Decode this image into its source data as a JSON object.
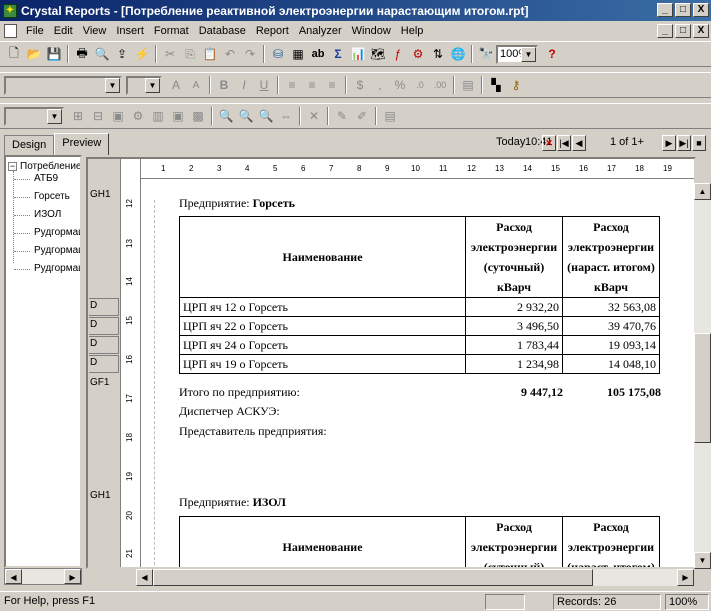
{
  "window": {
    "app_name": "Crystal Reports",
    "document": "[Потребление реактивной электроэнергии нарастающим итогом.rpt]",
    "app_icon": "crystal-reports-icon",
    "minimize": "_",
    "maximize": "□",
    "close": "X"
  },
  "menu": [
    "File",
    "Edit",
    "View",
    "Insert",
    "Format",
    "Database",
    "Report",
    "Analyzer",
    "Window",
    "Help"
  ],
  "toolbar": {
    "zoom": "100%"
  },
  "tabs": {
    "design": "Design",
    "preview": "Preview"
  },
  "tree": {
    "root": "Потребление р",
    "items": [
      "АТБ9",
      "Горсеть",
      "ИЗОЛ",
      "Рудгормащ",
      "Рудгормащ",
      "Рудгормащ"
    ]
  },
  "nav": {
    "today": "Today",
    "time": "10:41",
    "page": "1 of 1+"
  },
  "sections": {
    "gh": "GH1",
    "detail": "D",
    "gf": "GF1"
  },
  "ruler": {
    "h": [
      "1",
      "2",
      "3",
      "4",
      "5",
      "6",
      "7",
      "8",
      "9",
      "10",
      "11",
      "12",
      "13",
      "14",
      "15",
      "16",
      "17",
      "18",
      "19"
    ],
    "v": [
      "12",
      "13",
      "14",
      "15",
      "16",
      "17",
      "18",
      "19",
      "20",
      "21"
    ]
  },
  "report": {
    "group1": {
      "label": "Предприятие:",
      "name": "Горсеть",
      "col_name": "Наименование",
      "col_daily": [
        "Расход",
        "электроэнергии",
        "(суточный)",
        "кВарч"
      ],
      "col_cumul": [
        "Расход",
        "электроэнергии",
        "(нараст. итогом)",
        "кВарч"
      ],
      "rows": [
        {
          "name": "ЦРП яч 12 о Горсеть",
          "daily": "2 932,20",
          "cumul": "32 563,08"
        },
        {
          "name": "ЦРП яч 22 о Горсеть",
          "daily": "3 496,50",
          "cumul": "39 470,76"
        },
        {
          "name": "ЦРП яч 24 о Горсеть",
          "daily": "1 783,44",
          "cumul": "19 093,14"
        },
        {
          "name": "ЦРП яч 19 о Горсеть",
          "daily": "1 234,98",
          "cumul": "14 048,10"
        }
      ],
      "total_label": "Итого по предприятию:",
      "total_daily": "9 447,12",
      "total_cumul": "105 175,08",
      "dispatcher": "Диспетчер АСКУЭ:",
      "representative": "Представитель предприятия:"
    },
    "group2": {
      "label": "Предприятие:",
      "name": "ИЗОЛ",
      "col_name": "Наименование",
      "col_daily": [
        "Расход",
        "электроэнергии",
        "(суточный)"
      ],
      "col_cumul": [
        "Расход",
        "электроэнергии",
        "(нараст. итогом)"
      ]
    }
  },
  "status": {
    "help": "For Help, press F1",
    "records": "Records: 26",
    "zoom": "100%"
  }
}
